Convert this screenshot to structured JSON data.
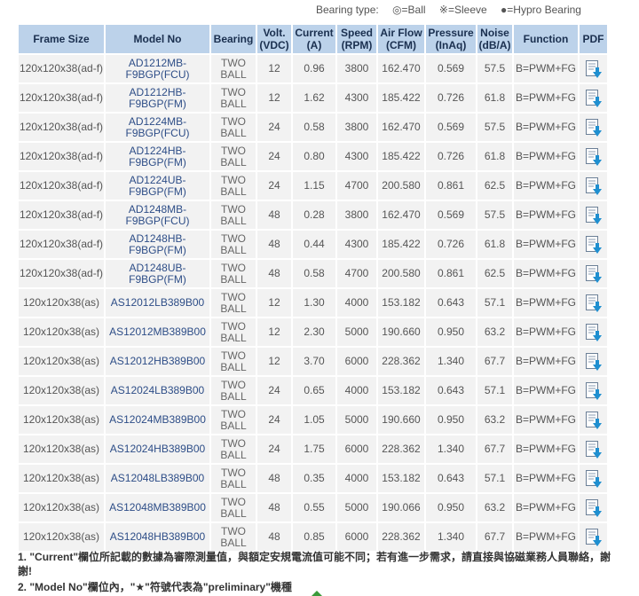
{
  "legend": {
    "label": "Bearing type:",
    "ball": "◎=Ball",
    "sleeve": "※=Sleeve",
    "hypro": "●=Hypro Bearing"
  },
  "headers": {
    "frame": "Frame Size",
    "model": "Model No",
    "bearing": "Bearing",
    "volt": "Volt. (VDC)",
    "current": "Current (A)",
    "speed": "Speed (RPM)",
    "airflow": "Air Flow (CFM)",
    "pressure": "Pressure (InAq)",
    "noise": "Noise (dB/A)",
    "function": "Function",
    "pdf": "PDF"
  },
  "rows": [
    {
      "frame": "120x120x38(ad-f)",
      "model": "AD1212MB-F9BGP(FCU)",
      "bearing": "TWO BALL",
      "volt": "12",
      "current": "0.96",
      "speed": "3800",
      "airflow": "162.470",
      "pressure": "0.569",
      "noise": "57.5",
      "function": "B=PWM+FG"
    },
    {
      "frame": "120x120x38(ad-f)",
      "model": "AD1212HB-F9BGP(FM)",
      "bearing": "TWO BALL",
      "volt": "12",
      "current": "1.62",
      "speed": "4300",
      "airflow": "185.422",
      "pressure": "0.726",
      "noise": "61.8",
      "function": "B=PWM+FG"
    },
    {
      "frame": "120x120x38(ad-f)",
      "model": "AD1224MB-F9BGP(FCU)",
      "bearing": "TWO BALL",
      "volt": "24",
      "current": "0.58",
      "speed": "3800",
      "airflow": "162.470",
      "pressure": "0.569",
      "noise": "57.5",
      "function": "B=PWM+FG"
    },
    {
      "frame": "120x120x38(ad-f)",
      "model": "AD1224HB-F9BGP(FM)",
      "bearing": "TWO BALL",
      "volt": "24",
      "current": "0.80",
      "speed": "4300",
      "airflow": "185.422",
      "pressure": "0.726",
      "noise": "61.8",
      "function": "B=PWM+FG"
    },
    {
      "frame": "120x120x38(ad-f)",
      "model": "AD1224UB-F9BGP(FM)",
      "bearing": "TWO BALL",
      "volt": "24",
      "current": "1.15",
      "speed": "4700",
      "airflow": "200.580",
      "pressure": "0.861",
      "noise": "62.5",
      "function": "B=PWM+FG"
    },
    {
      "frame": "120x120x38(ad-f)",
      "model": "AD1248MB-F9BGP(FCU)",
      "bearing": "TWO BALL",
      "volt": "48",
      "current": "0.28",
      "speed": "3800",
      "airflow": "162.470",
      "pressure": "0.569",
      "noise": "57.5",
      "function": "B=PWM+FG"
    },
    {
      "frame": "120x120x38(ad-f)",
      "model": "AD1248HB-F9BGP(FM)",
      "bearing": "TWO BALL",
      "volt": "48",
      "current": "0.44",
      "speed": "4300",
      "airflow": "185.422",
      "pressure": "0.726",
      "noise": "61.8",
      "function": "B=PWM+FG"
    },
    {
      "frame": "120x120x38(ad-f)",
      "model": "AD1248UB-F9BGP(FM)",
      "bearing": "TWO BALL",
      "volt": "48",
      "current": "0.58",
      "speed": "4700",
      "airflow": "200.580",
      "pressure": "0.861",
      "noise": "62.5",
      "function": "B=PWM+FG"
    },
    {
      "frame": "120x120x38(as)",
      "model": "AS12012LB389B00",
      "bearing": "TWO BALL",
      "volt": "12",
      "current": "1.30",
      "speed": "4000",
      "airflow": "153.182",
      "pressure": "0.643",
      "noise": "57.1",
      "function": "B=PWM+FG"
    },
    {
      "frame": "120x120x38(as)",
      "model": "AS12012MB389B00",
      "bearing": "TWO BALL",
      "volt": "12",
      "current": "2.30",
      "speed": "5000",
      "airflow": "190.660",
      "pressure": "0.950",
      "noise": "63.2",
      "function": "B=PWM+FG"
    },
    {
      "frame": "120x120x38(as)",
      "model": "AS12012HB389B00",
      "bearing": "TWO BALL",
      "volt": "12",
      "current": "3.70",
      "speed": "6000",
      "airflow": "228.362",
      "pressure": "1.340",
      "noise": "67.7",
      "function": "B=PWM+FG"
    },
    {
      "frame": "120x120x38(as)",
      "model": "AS12024LB389B00",
      "bearing": "TWO BALL",
      "volt": "24",
      "current": "0.65",
      "speed": "4000",
      "airflow": "153.182",
      "pressure": "0.643",
      "noise": "57.1",
      "function": "B=PWM+FG"
    },
    {
      "frame": "120x120x38(as)",
      "model": "AS12024MB389B00",
      "bearing": "TWO BALL",
      "volt": "24",
      "current": "1.05",
      "speed": "5000",
      "airflow": "190.660",
      "pressure": "0.950",
      "noise": "63.2",
      "function": "B=PWM+FG"
    },
    {
      "frame": "120x120x38(as)",
      "model": "AS12024HB389B00",
      "bearing": "TWO BALL",
      "volt": "24",
      "current": "1.75",
      "speed": "6000",
      "airflow": "228.362",
      "pressure": "1.340",
      "noise": "67.7",
      "function": "B=PWM+FG"
    },
    {
      "frame": "120x120x38(as)",
      "model": "AS12048LB389B00",
      "bearing": "TWO BALL",
      "volt": "48",
      "current": "0.35",
      "speed": "4000",
      "airflow": "153.182",
      "pressure": "0.643",
      "noise": "57.1",
      "function": "B=PWM+FG"
    },
    {
      "frame": "120x120x38(as)",
      "model": "AS12048MB389B00",
      "bearing": "TWO BALL",
      "volt": "48",
      "current": "0.55",
      "speed": "5000",
      "airflow": "190.066",
      "pressure": "0.950",
      "noise": "63.2",
      "function": "B=PWM+FG"
    },
    {
      "frame": "120x120x38(as)",
      "model": "AS12048HB389B00",
      "bearing": "TWO BALL",
      "volt": "48",
      "current": "0.85",
      "speed": "6000",
      "airflow": "228.362",
      "pressure": "1.340",
      "noise": "67.7",
      "function": "B=PWM+FG"
    }
  ],
  "notes": [
    "1. \"Current\"欄位所記載的數據為審際測量值，與額定安規電流值可能不同；若有進一步需求，請直接與協磁業務人員聯絡，謝謝!",
    "2. \"Model No\"欄位內，\"★\"符號代表為\"preliminary\"機種"
  ],
  "icons": {
    "pdf": "pdf-download-icon",
    "scroll": "scroll-up-icon"
  },
  "colors": {
    "header_bg": "#bcd2ea",
    "row_bg": "#f2f2f2",
    "link": "#2d4d87",
    "icon_blue": "#1f8fd0",
    "scroll_green": "#3a9a3a"
  }
}
